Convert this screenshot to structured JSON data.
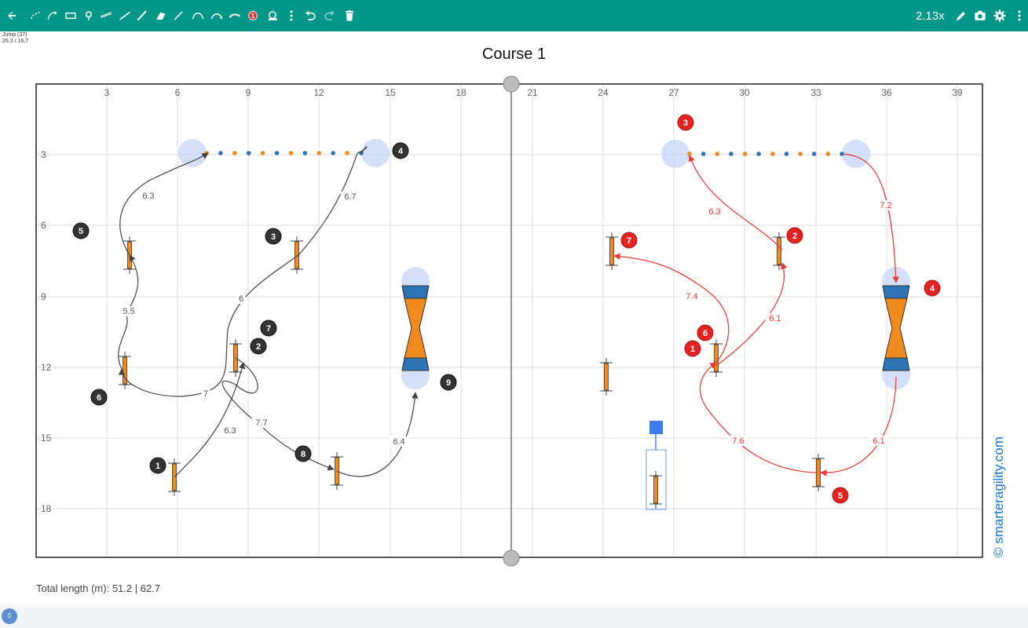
{
  "toolbar": {
    "zoom": "2.13x",
    "tools": [
      "back-icon",
      "tunnel-tool-icon",
      "jump-tool-icon",
      "panel-tool-icon",
      "tire-tool-icon",
      "long-jump-tool-icon",
      "weaves-tool-icon",
      "dogwalk-tool-icon",
      "aframe-tool-icon",
      "pen-tool-icon",
      "curve-tool-icon",
      "curve-rev-tool-icon",
      "line-tool-icon",
      "number-tool-icon",
      "table-tool-icon",
      "more-vert-icon",
      "undo-icon",
      "redo-icon",
      "delete-icon"
    ],
    "number_badge": "1",
    "right_tools": [
      "edit-icon",
      "camera-icon",
      "gear-icon",
      "more-vert-icon"
    ]
  },
  "info": {
    "line1": "Jump (37)",
    "line2": "26.3 / 16.7"
  },
  "title": "Course 1",
  "axis": {
    "x_ticks": [
      "3",
      "6",
      "9",
      "12",
      "15",
      "18",
      "21",
      "24",
      "27",
      "30",
      "33",
      "36",
      "39"
    ],
    "y_ticks": [
      "3",
      "6",
      "9",
      "12",
      "15",
      "18"
    ]
  },
  "course1": {
    "numbers": [
      "1",
      "2",
      "3",
      "4",
      "5",
      "6",
      "7",
      "8",
      "9"
    ],
    "distances": [
      "6.3",
      "6.7",
      "5.5",
      "6",
      "7",
      "7.7",
      "6.3",
      "6.4"
    ]
  },
  "course2": {
    "numbers": [
      "1",
      "2",
      "3",
      "4",
      "5",
      "6",
      "7"
    ],
    "distances": [
      "6.3",
      "7.2",
      "6.1",
      "7.4",
      "7.6",
      "6.1"
    ]
  },
  "total_length": "Total length (m): 51.2 | 62.7",
  "copyright": "© smarteragility.com",
  "fab": "0",
  "colors": {
    "toolbar": "#009688",
    "course1_path": "#444444",
    "course2_path": "#e53935",
    "jump_bar": "#ef8a1e",
    "tunnel_blue": "#2e74b5"
  }
}
